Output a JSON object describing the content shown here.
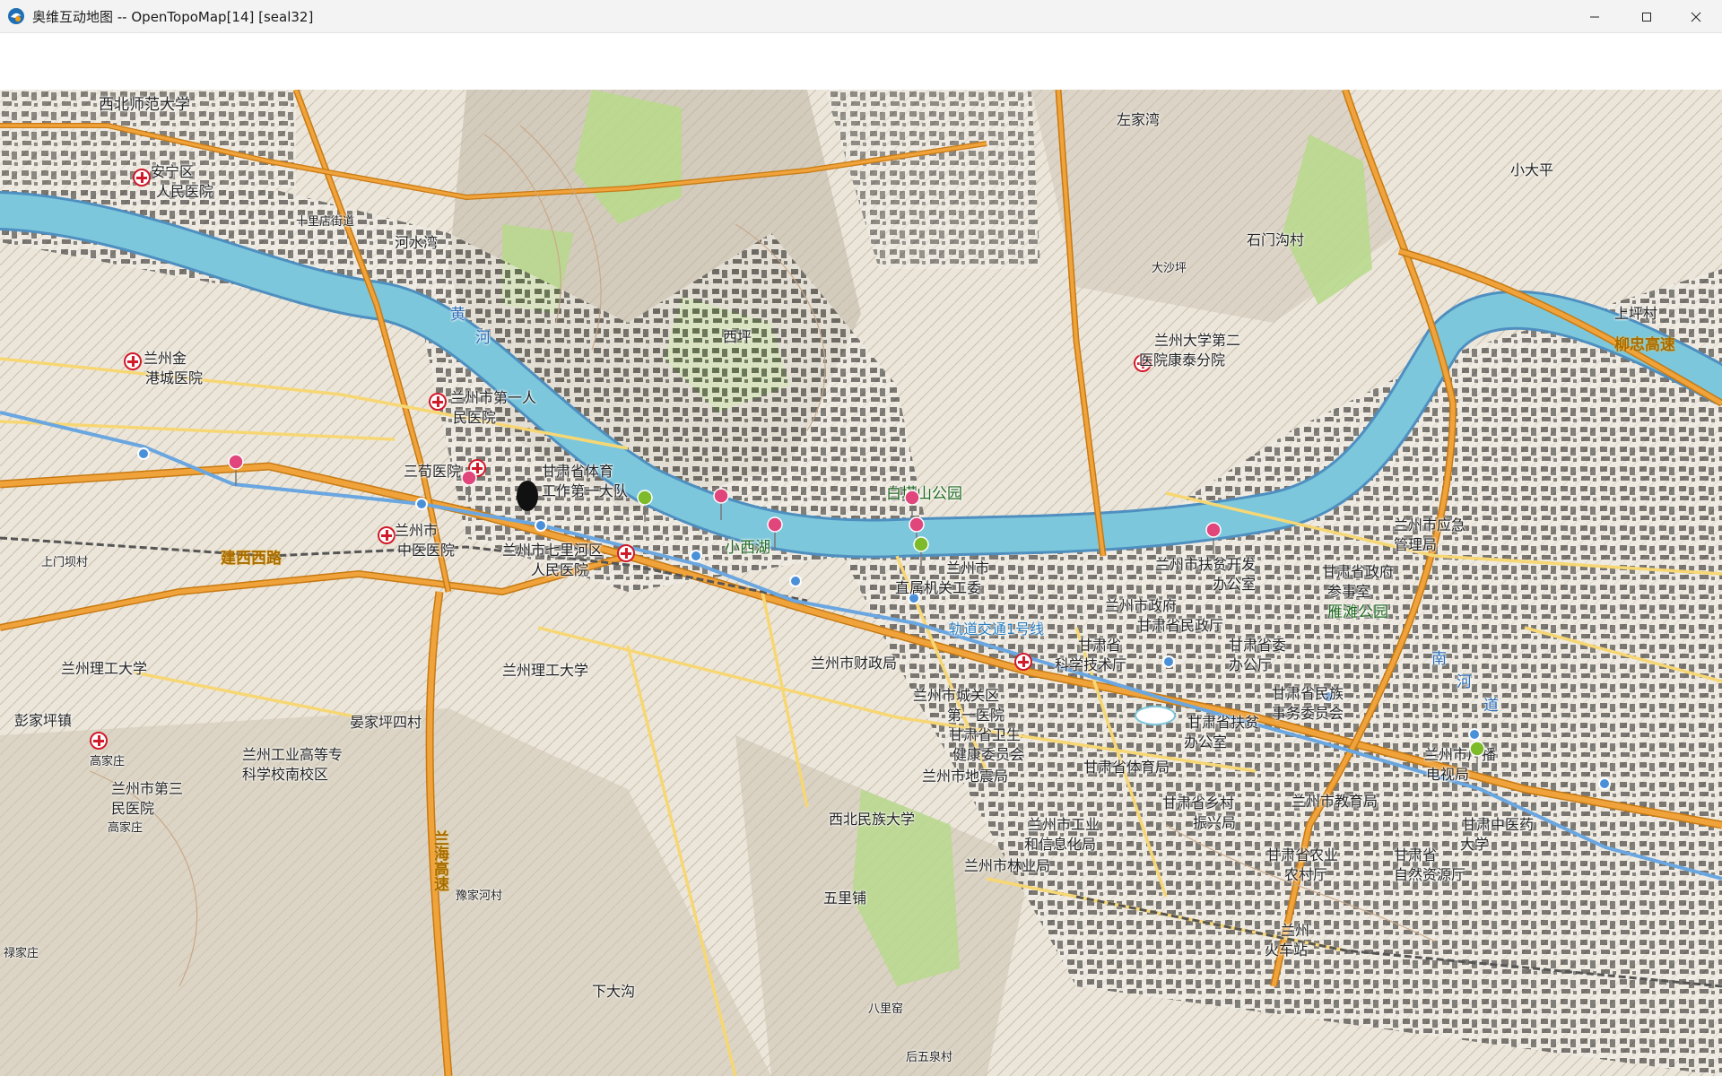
{
  "window": {
    "title": "奥维互动地图 -- OpenTopoMap[14] [seal32]",
    "controls": {
      "minimize": "minimize",
      "maximize": "maximize",
      "close": "close"
    }
  },
  "colors": {
    "river": "#7cc7dc",
    "river_bank": "#4f8fc0",
    "highway": "#f0a33a",
    "road": "#f7d774",
    "terrain": "#e9e4da",
    "forest": "#b7d98a",
    "pin_pink": "#e0457b",
    "pin_green": "#7dbb2a",
    "metro": "#4a90d9",
    "hospital": "#d11a2a"
  },
  "map": {
    "provider": "OpenTopoMap",
    "zoom": "14",
    "labels": [
      {
        "text": "西北师范大学",
        "cls": "big"
      },
      {
        "text": "安宁区",
        "cls": "med"
      },
      {
        "text": "人民医院",
        "cls": "med"
      },
      {
        "text": "十里店街道",
        "cls": "sml"
      },
      {
        "text": "河水湾",
        "cls": "med"
      },
      {
        "text": "黄",
        "cls": "river"
      },
      {
        "text": "河",
        "cls": "river"
      },
      {
        "text": "兰州金",
        "cls": "med"
      },
      {
        "text": "港城医院",
        "cls": "med"
      },
      {
        "text": "兰州市第一人",
        "cls": "med"
      },
      {
        "text": "民医院",
        "cls": "med"
      },
      {
        "text": "三荀医院",
        "cls": "med"
      },
      {
        "text": "甘肃省体育",
        "cls": "med"
      },
      {
        "text": "工作第一大队",
        "cls": "med"
      },
      {
        "text": "兰州市",
        "cls": "med"
      },
      {
        "text": "中医医院",
        "cls": "med"
      },
      {
        "text": "兰州市七里河区",
        "cls": "med"
      },
      {
        "text": "人民医院",
        "cls": "med"
      },
      {
        "text": "建西西路",
        "cls": "road"
      },
      {
        "text": "小西湖",
        "cls": "park"
      },
      {
        "text": "白塔山公园",
        "cls": "park"
      },
      {
        "text": "西坪",
        "cls": "med"
      },
      {
        "text": "左家湾",
        "cls": "med"
      },
      {
        "text": "石门沟村",
        "cls": "med"
      },
      {
        "text": "小大平",
        "cls": "med"
      },
      {
        "text": "上坪村",
        "cls": "med"
      },
      {
        "text": "柳忠高速",
        "cls": "road"
      },
      {
        "text": "兰州大学第二",
        "cls": "med"
      },
      {
        "text": "医院康泰分院",
        "cls": "med"
      },
      {
        "text": "兰州市",
        "cls": "med"
      },
      {
        "text": "直属机关工委",
        "cls": "med"
      },
      {
        "text": "兰州市扶贫开发",
        "cls": "med"
      },
      {
        "text": "办公室",
        "cls": "med"
      },
      {
        "text": "甘肃省政府",
        "cls": "med"
      },
      {
        "text": "参事室",
        "cls": "med"
      },
      {
        "text": "雁滩公园",
        "cls": "park"
      },
      {
        "text": "兰州市应急",
        "cls": "med"
      },
      {
        "text": "管理局",
        "cls": "med"
      },
      {
        "text": "兰州市政府",
        "cls": "med"
      },
      {
        "text": "甘肃省民政厅",
        "cls": "med"
      },
      {
        "text": "甘肃省委",
        "cls": "med"
      },
      {
        "text": "办公厅",
        "cls": "med"
      },
      {
        "text": "兰州市财政局",
        "cls": "med"
      },
      {
        "text": "轨道交通1号线",
        "cls": "rail"
      },
      {
        "text": "甘肃省",
        "cls": "med"
      },
      {
        "text": "科学技术厅",
        "cls": "med"
      },
      {
        "text": "兰州市城关区",
        "cls": "med"
      },
      {
        "text": "第一医院",
        "cls": "med"
      },
      {
        "text": "甘肃省民族",
        "cls": "med"
      },
      {
        "text": "事务委员会",
        "cls": "med"
      },
      {
        "text": "甘肃省扶贫",
        "cls": "med"
      },
      {
        "text": "办公室",
        "cls": "med"
      },
      {
        "text": "甘肃省卫生",
        "cls": "med"
      },
      {
        "text": "健康委员会",
        "cls": "med"
      },
      {
        "text": "甘肃省体育局",
        "cls": "med"
      },
      {
        "text": "兰州市地震局",
        "cls": "med"
      },
      {
        "text": "甘肃省乡村",
        "cls": "med"
      },
      {
        "text": "振兴局",
        "cls": "med"
      },
      {
        "text": "兰州市教育局",
        "cls": "med"
      },
      {
        "text": "兰州市工业",
        "cls": "med"
      },
      {
        "text": "和信息化局",
        "cls": "med"
      },
      {
        "text": "甘肃省农业",
        "cls": "med"
      },
      {
        "text": "农村厅",
        "cls": "med"
      },
      {
        "text": "甘肃省",
        "cls": "med"
      },
      {
        "text": "自然资源厅",
        "cls": "med"
      },
      {
        "text": "兰州市林业局",
        "cls": "med"
      },
      {
        "text": "兰州市广播",
        "cls": "med"
      },
      {
        "text": "电视局",
        "cls": "med"
      },
      {
        "text": "甘肃中医药",
        "cls": "med"
      },
      {
        "text": "大学",
        "cls": "med"
      },
      {
        "text": "兰州",
        "cls": "med"
      },
      {
        "text": "火车站",
        "cls": "med"
      },
      {
        "text": "西北民族大学",
        "cls": "med"
      },
      {
        "text": "兰州理工大学",
        "cls": "med"
      },
      {
        "text": "兰州理工大学",
        "cls": "med"
      },
      {
        "text": "彭家坪镇",
        "cls": "med"
      },
      {
        "text": "晏家坪四村",
        "cls": "med"
      },
      {
        "text": "兰州工业高等专",
        "cls": "med"
      },
      {
        "text": "科学校南校区",
        "cls": "med"
      },
      {
        "text": "兰州市第三",
        "cls": "med"
      },
      {
        "text": "民医院",
        "cls": "med"
      },
      {
        "text": "高家庄",
        "cls": "sml"
      },
      {
        "text": "高家庄",
        "cls": "sml"
      },
      {
        "text": "兰海高速",
        "cls": "road"
      },
      {
        "text": "豫家河村",
        "cls": "sml"
      },
      {
        "text": "五里铺",
        "cls": "med"
      },
      {
        "text": "下大沟",
        "cls": "med"
      },
      {
        "text": "八里窑",
        "cls": "sml"
      },
      {
        "text": "后五泉村",
        "cls": "sml"
      },
      {
        "text": "上门坝村",
        "cls": "sml"
      },
      {
        "text": "禄家庄",
        "cls": "sml"
      },
      {
        "text": "大沙坪",
        "cls": "sml"
      },
      {
        "text": "南",
        "cls": "river"
      },
      {
        "text": "河",
        "cls": "river"
      },
      {
        "text": "道",
        "cls": "river"
      }
    ],
    "pins": [
      {
        "color": "pink",
        "name": "pin-1"
      },
      {
        "color": "pink",
        "name": "pin-2"
      },
      {
        "color": "green",
        "name": "pin-3"
      },
      {
        "color": "pink",
        "name": "pin-4"
      },
      {
        "color": "pink",
        "name": "pin-5"
      },
      {
        "color": "pink",
        "name": "pin-6"
      },
      {
        "color": "pink",
        "name": "pin-7"
      },
      {
        "color": "green",
        "name": "pin-8"
      },
      {
        "color": "pink",
        "name": "pin-9"
      },
      {
        "color": "green",
        "name": "pin-10"
      }
    ]
  }
}
